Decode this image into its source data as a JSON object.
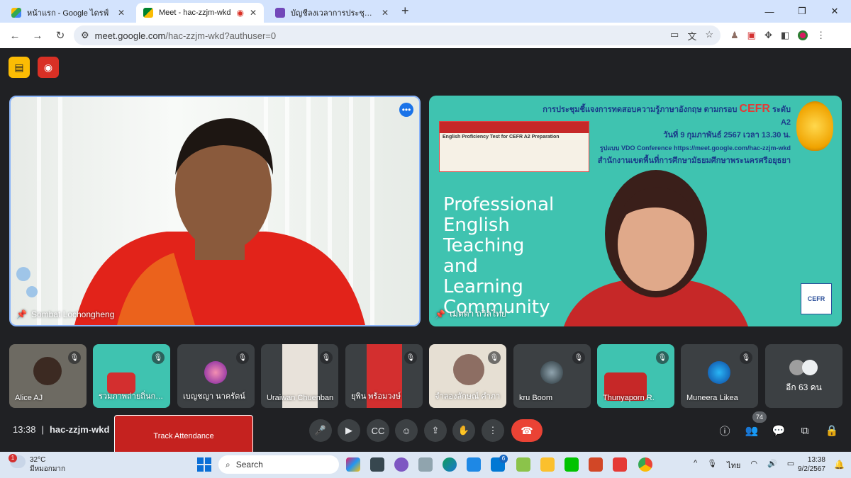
{
  "browser": {
    "tabs": [
      {
        "title": "หน้าแรก - Google ไดรฟ์",
        "favicon_color": "#34a853"
      },
      {
        "title": "Meet - hac-zzjm-wkd",
        "favicon_color": "#00832d"
      },
      {
        "title": "บัญชีลงเวลาการประชุมสอบ CEFR ปีงบ",
        "favicon_color": "#7248b9"
      }
    ],
    "url": {
      "host": "meet.google.com",
      "path": "/hac-zzjm-wkd?authuser=0"
    }
  },
  "meet": {
    "main_tiles": [
      {
        "name": "Sombat Lochongheng"
      },
      {
        "name": "เมตตา ถวิลไทย"
      }
    ],
    "slide": {
      "header_line1": "การประชุมชี้แจงการทดสอบความรู้ภาษาอังกฤษ ตามกรอบ",
      "header_cefr": "CEFR",
      "header_level": "ระดับ A2",
      "header_line2": "วันที่ 9 กุมภาพันธ์ 2567 เวลา 13.30 น.",
      "header_line3": "รูปแบบ VDO Conference https://meet.google.com/hac-zzjm-wkd",
      "header_line4": "สำนักงานเขตพื้นที่การศึกษามัธยมศึกษาพระนครศรีอยุธยา",
      "banner_title": "English Proficiency Test for CEFR A2 Preparation",
      "text_lines": [
        "Professional",
        "English",
        "Teaching",
        "and",
        "Learning",
        "Community"
      ],
      "badge": "CEFR"
    },
    "thumbnails": [
      {
        "name": "Alice AJ",
        "muted": true
      },
      {
        "name": "รวมภาพถ่ายถิ่นกองการศึกษา",
        "muted": true
      },
      {
        "name": "เบญชญา นาครัตน์",
        "muted": true
      },
      {
        "name": "Uraiwan Chuenban",
        "muted": true
      },
      {
        "name": "ยุพิน พร้อมวงษ์",
        "muted": true
      },
      {
        "name": "จำลองลักษณ์ คำภา",
        "muted": true
      },
      {
        "name": "kru Boom",
        "muted": true
      },
      {
        "name": "Thunyaporn R.",
        "muted": true
      },
      {
        "name": "Muneera Likea",
        "muted": true
      }
    ],
    "others_label": "อีก 63 คน",
    "time": "13:38",
    "meeting_code": "hac-zzjm-wkd",
    "track_button": "Track Attendance",
    "participant_count": "74"
  },
  "taskbar": {
    "weather_temp": "32°C",
    "weather_desc": "มีหมอกมาก",
    "weather_badge": "1",
    "search_label": "Search",
    "lang": "ไทย",
    "clock_time": "13:38",
    "clock_date": "9/2/2567",
    "mail_badge": "6"
  },
  "icons": {
    "accent": "#1a73e8",
    "end_call_color": "#ea4335",
    "track_color": "#c5221f"
  }
}
